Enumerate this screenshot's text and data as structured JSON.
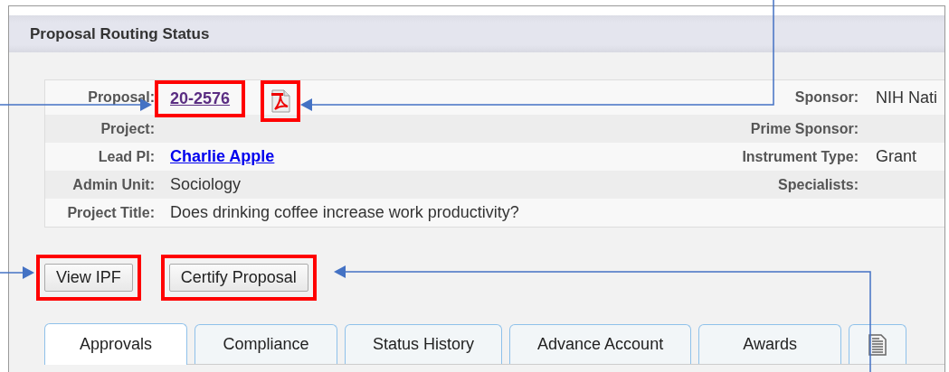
{
  "panel": {
    "title": "Proposal Routing Status"
  },
  "details": [
    {
      "label": "Proposal:",
      "value": "20-2576",
      "kind": "visited-link",
      "highlighted": true,
      "pdf_icon": {
        "highlighted": true
      },
      "right": {
        "label": "Sponsor:",
        "value": "NIH Nati"
      }
    },
    {
      "label": "Project:",
      "kind": "none",
      "highlighted": false,
      "right": {
        "label": "Prime Sponsor:"
      }
    },
    {
      "label": "Lead PI:",
      "value": "Charlie Apple",
      "kind": "link",
      "highlighted": false,
      "right": {
        "label": "Instrument Type:",
        "value": "Grant"
      }
    },
    {
      "label": "Admin Unit:",
      "value": "Sociology",
      "kind": "text",
      "highlighted": false,
      "right": {
        "label": "Specialists:"
      }
    },
    {
      "label": "Project Title:",
      "value": "Does drinking coffee increase work productivity?",
      "kind": "text",
      "highlighted": false
    }
  ],
  "buttons": [
    {
      "label": "View IPF",
      "highlighted": true
    },
    {
      "label": "Certify Proposal",
      "highlighted": true
    }
  ],
  "tabs": [
    {
      "label": "Approvals",
      "kind": "text",
      "selected": true
    },
    {
      "label": "Compliance",
      "kind": "text",
      "selected": false
    },
    {
      "label": "Status History",
      "kind": "text",
      "selected": false
    },
    {
      "label": "Advance Account",
      "kind": "text",
      "selected": false
    },
    {
      "label": "Awards",
      "kind": "text",
      "selected": false
    },
    {
      "kind": "icon",
      "selected": false
    }
  ]
}
